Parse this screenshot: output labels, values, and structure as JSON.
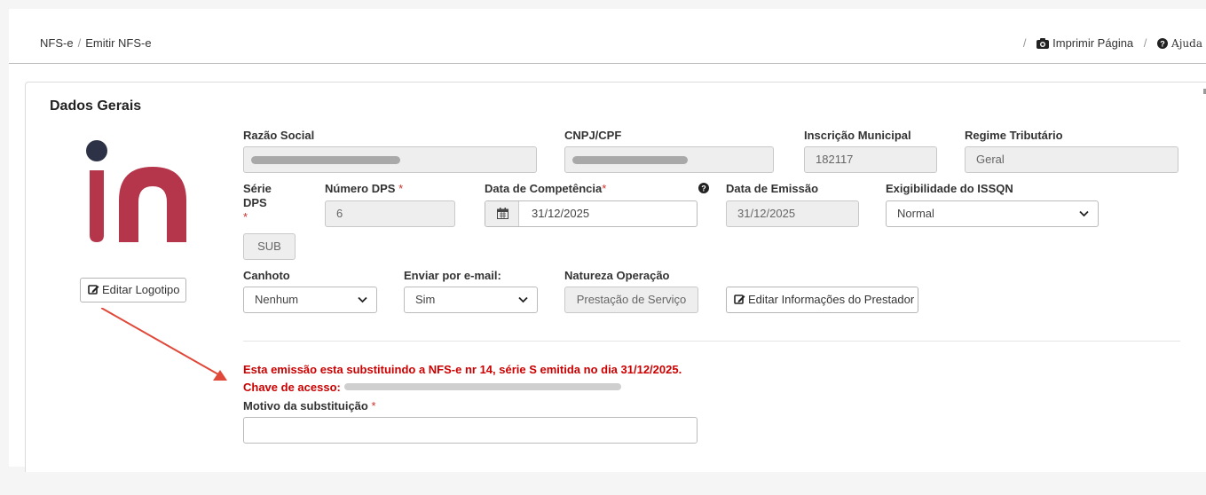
{
  "breadcrumb": {
    "root": "NFS-e",
    "current": "Emitir NFS-e"
  },
  "header_actions": {
    "print_label": "Imprimir Página",
    "help_label": "Ajuda"
  },
  "section": {
    "title": "Dados Gerais"
  },
  "logo": {
    "button_label": "Editar Logotipo",
    "colors": {
      "letters": "#b5364b",
      "dot": "#2d3247"
    }
  },
  "form": {
    "razao_social": {
      "label": "Razão Social"
    },
    "cnpj_cpf": {
      "label": "CNPJ/CPF"
    },
    "inscricao_municipal": {
      "label": "Inscrição Municipal",
      "value": "182117"
    },
    "regime_tributario": {
      "label": "Regime Tributário",
      "value": "Geral"
    },
    "serie_dps": {
      "label_line1": "Série",
      "label_line2": "DPS",
      "value": "SUB"
    },
    "numero_dps": {
      "label": "Número DPS",
      "value": "6"
    },
    "data_competencia": {
      "label": "Data de Competência",
      "value": "31/12/2025"
    },
    "data_emissao": {
      "label": "Data de Emissão",
      "value": "31/12/2025"
    },
    "exigibilidade_issqn": {
      "label": "Exigibilidade do ISSQN",
      "value": "Normal"
    },
    "canhoto": {
      "label": "Canhoto",
      "value": "Nenhum"
    },
    "enviar_email": {
      "label": "Enviar por e-mail:",
      "value": "Sim"
    },
    "natureza_operacao": {
      "label": "Natureza Operação",
      "value": "Prestação de Serviço"
    },
    "editar_prestador": {
      "label": "Editar Informações do Prestador"
    },
    "required_mark": "*"
  },
  "substitution": {
    "notice": "Esta emissão esta substituindo a NFS-e nr 14, série S emitida no dia 31/12/2025.",
    "chave_label": "Chave de acesso:",
    "motivo_label": "Motivo da substituição",
    "motivo_value": "",
    "colors": {
      "warning": "#cc0000"
    }
  },
  "annotation": {
    "arrow_color": "#e0483a"
  }
}
